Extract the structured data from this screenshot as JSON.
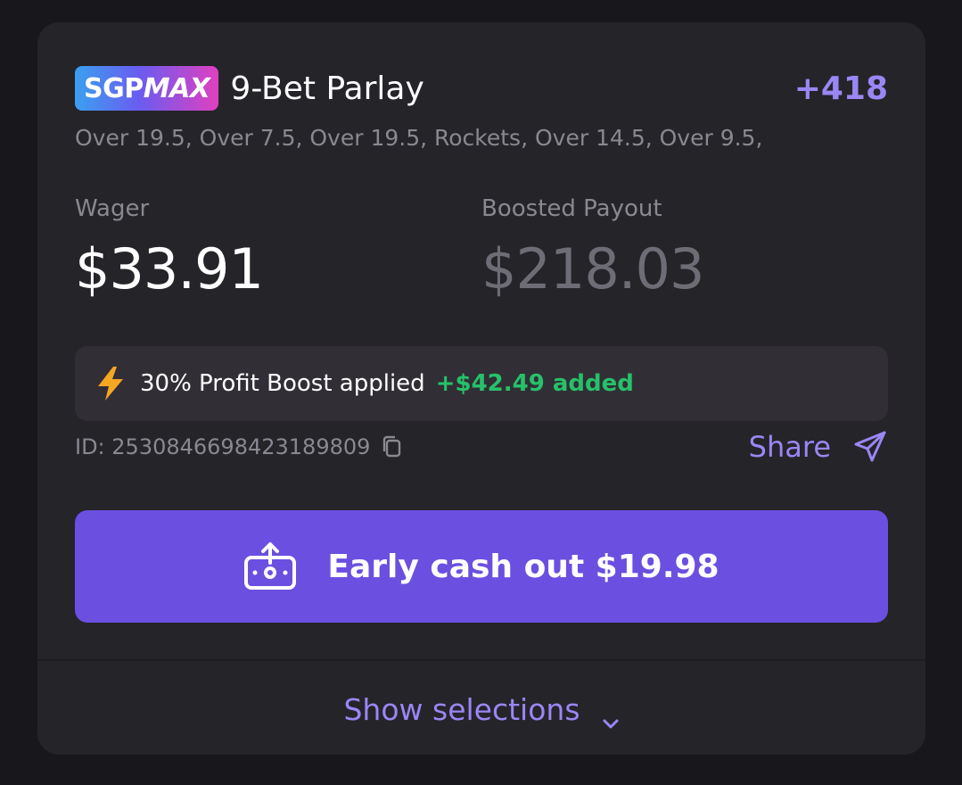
{
  "bet": {
    "badge_sgp": "SGP",
    "badge_max": "MAX",
    "title": "9-Bet Parlay",
    "odds": "+418",
    "legs_summary": "Over 19.5, Over 7.5, Over 19.5, Rockets, Over 14.5, Over 9.5,"
  },
  "wager": {
    "label": "Wager",
    "value": "$33.91"
  },
  "payout": {
    "label": "Boosted Payout",
    "value": "$218.03"
  },
  "boost": {
    "icon": "lightning-bolt-icon",
    "text": "30% Profit Boost applied",
    "added": "+$42.49 added"
  },
  "meta": {
    "id_text": "ID: 2530846698423189809",
    "share_label": "Share"
  },
  "cashout": {
    "label": "Early cash out $19.98"
  },
  "footer": {
    "show_selections_label": "Show selections"
  },
  "colors": {
    "accent": "#9b86f5",
    "button": "#6b4fe0",
    "positive": "#26c16a",
    "bolt": "#f5a623",
    "card": "#252429",
    "background": "#18171b"
  }
}
